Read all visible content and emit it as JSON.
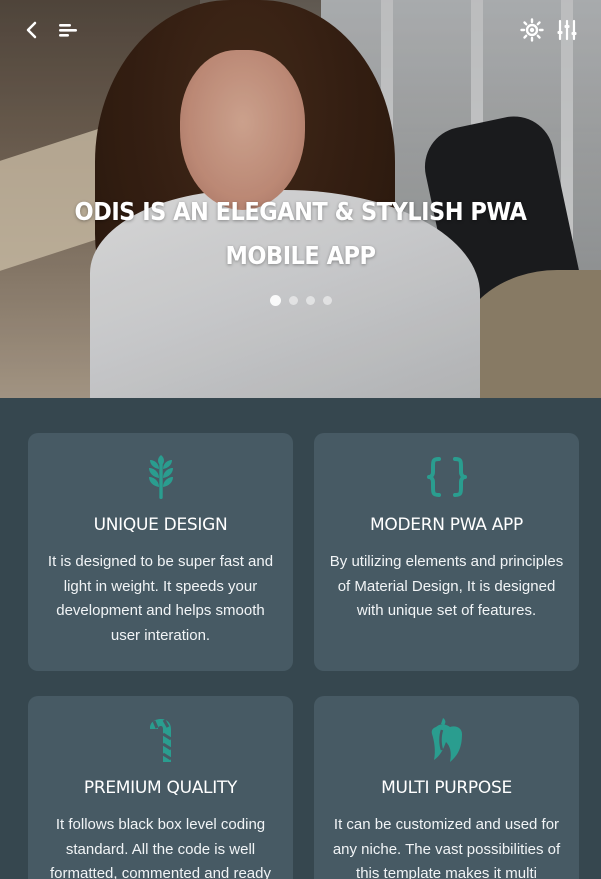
{
  "hero": {
    "title": "ODIS IS AN ELEGANT & STYLISH PWA MOBILE APP",
    "slides": 4,
    "active_slide": 1
  },
  "topbar": {
    "back_icon": "chevron-left-icon",
    "menu_icon": "menu-icon",
    "theme_icon": "sun-icon",
    "settings_icon": "sliders-icon"
  },
  "features": [
    {
      "icon": "wheat-icon",
      "title": "UNIQUE DESIGN",
      "text": "It is designed to be super fast and light in weight. It speeds your development and helps smooth user interation."
    },
    {
      "icon": "braces-icon",
      "title": "MODERN PWA APP",
      "text": "By utilizing elements and principles of Material Design, It is designed with unique set of features."
    },
    {
      "icon": "candy-cane-icon",
      "title": "PREMIUM QUALITY",
      "text": "It follows black box level coding standard. All the code is well formatted, commented and ready"
    },
    {
      "icon": "pepper-icon",
      "title": "MULTI PURPOSE",
      "text": "It can be customized and used for any niche. The vast possibilities of this template makes it multi"
    }
  ],
  "colors": {
    "background": "#36474f",
    "card": "#475a64",
    "accent": "#2a9d8f"
  }
}
